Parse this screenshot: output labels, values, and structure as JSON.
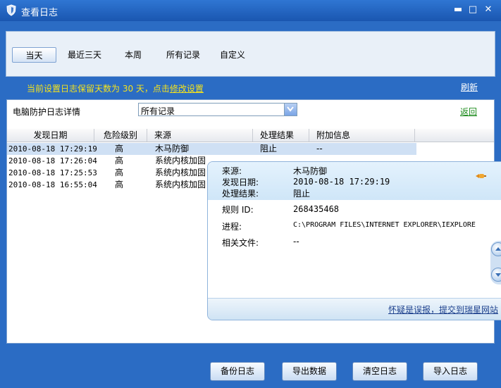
{
  "window": {
    "title": "查看日志",
    "minimize": "▬",
    "maximize": "□",
    "close": "✕"
  },
  "tabs": [
    {
      "label": "当天",
      "active": true
    },
    {
      "label": "最近三天",
      "active": false
    },
    {
      "label": "本周",
      "active": false
    },
    {
      "label": "所有记录",
      "active": false
    },
    {
      "label": "自定义",
      "active": false
    }
  ],
  "info": {
    "text": "当前设置日志保留天数为 30 天，点击",
    "link": "修改设置",
    "refresh": "刷新"
  },
  "filter": {
    "label": "电脑防护日志详情",
    "selected": "所有记录",
    "back": "返回"
  },
  "table": {
    "headers": [
      "发现日期",
      "危险级别",
      "来源",
      "处理结果",
      "附加信息"
    ],
    "rows": [
      {
        "date": "2010-08-18 17:29:19",
        "level": "高",
        "source": "木马防御",
        "result": "阻止",
        "extra": "--"
      },
      {
        "date": "2010-08-18 17:26:04",
        "level": "高",
        "source": "系统内核加固",
        "result": "",
        "extra": ""
      },
      {
        "date": "2010-08-18 17:25:53",
        "level": "高",
        "source": "系统内核加固",
        "result": "",
        "extra": ""
      },
      {
        "date": "2010-08-18 16:55:04",
        "level": "高",
        "source": "系统内核加固",
        "result": "",
        "extra": ""
      }
    ]
  },
  "detail": {
    "source_label": "来源:",
    "source": "木马防御",
    "date_label": "发现日期:",
    "date": "2010-08-18 17:29:19",
    "result_label": "处理结果:",
    "result": "阻止",
    "rule_label": "规则 ID:",
    "rule": "268435468",
    "process_label": "进程:",
    "process": "C:\\PROGRAM FILES\\INTERNET EXPLORER\\IEXPLORE",
    "file_label": "相关文件:",
    "file": "--",
    "report_link": "怀疑是误报，提交到瑞星网站"
  },
  "buttons": {
    "backup": "备份日志",
    "export": "导出数据",
    "clear": "清空日志",
    "import": "导入日志"
  },
  "colors": {
    "frame": "#2b6cc4",
    "info_text": "#f4e21c",
    "back_link": "#1a8a1a",
    "selected_row": "#cfe0f4"
  }
}
